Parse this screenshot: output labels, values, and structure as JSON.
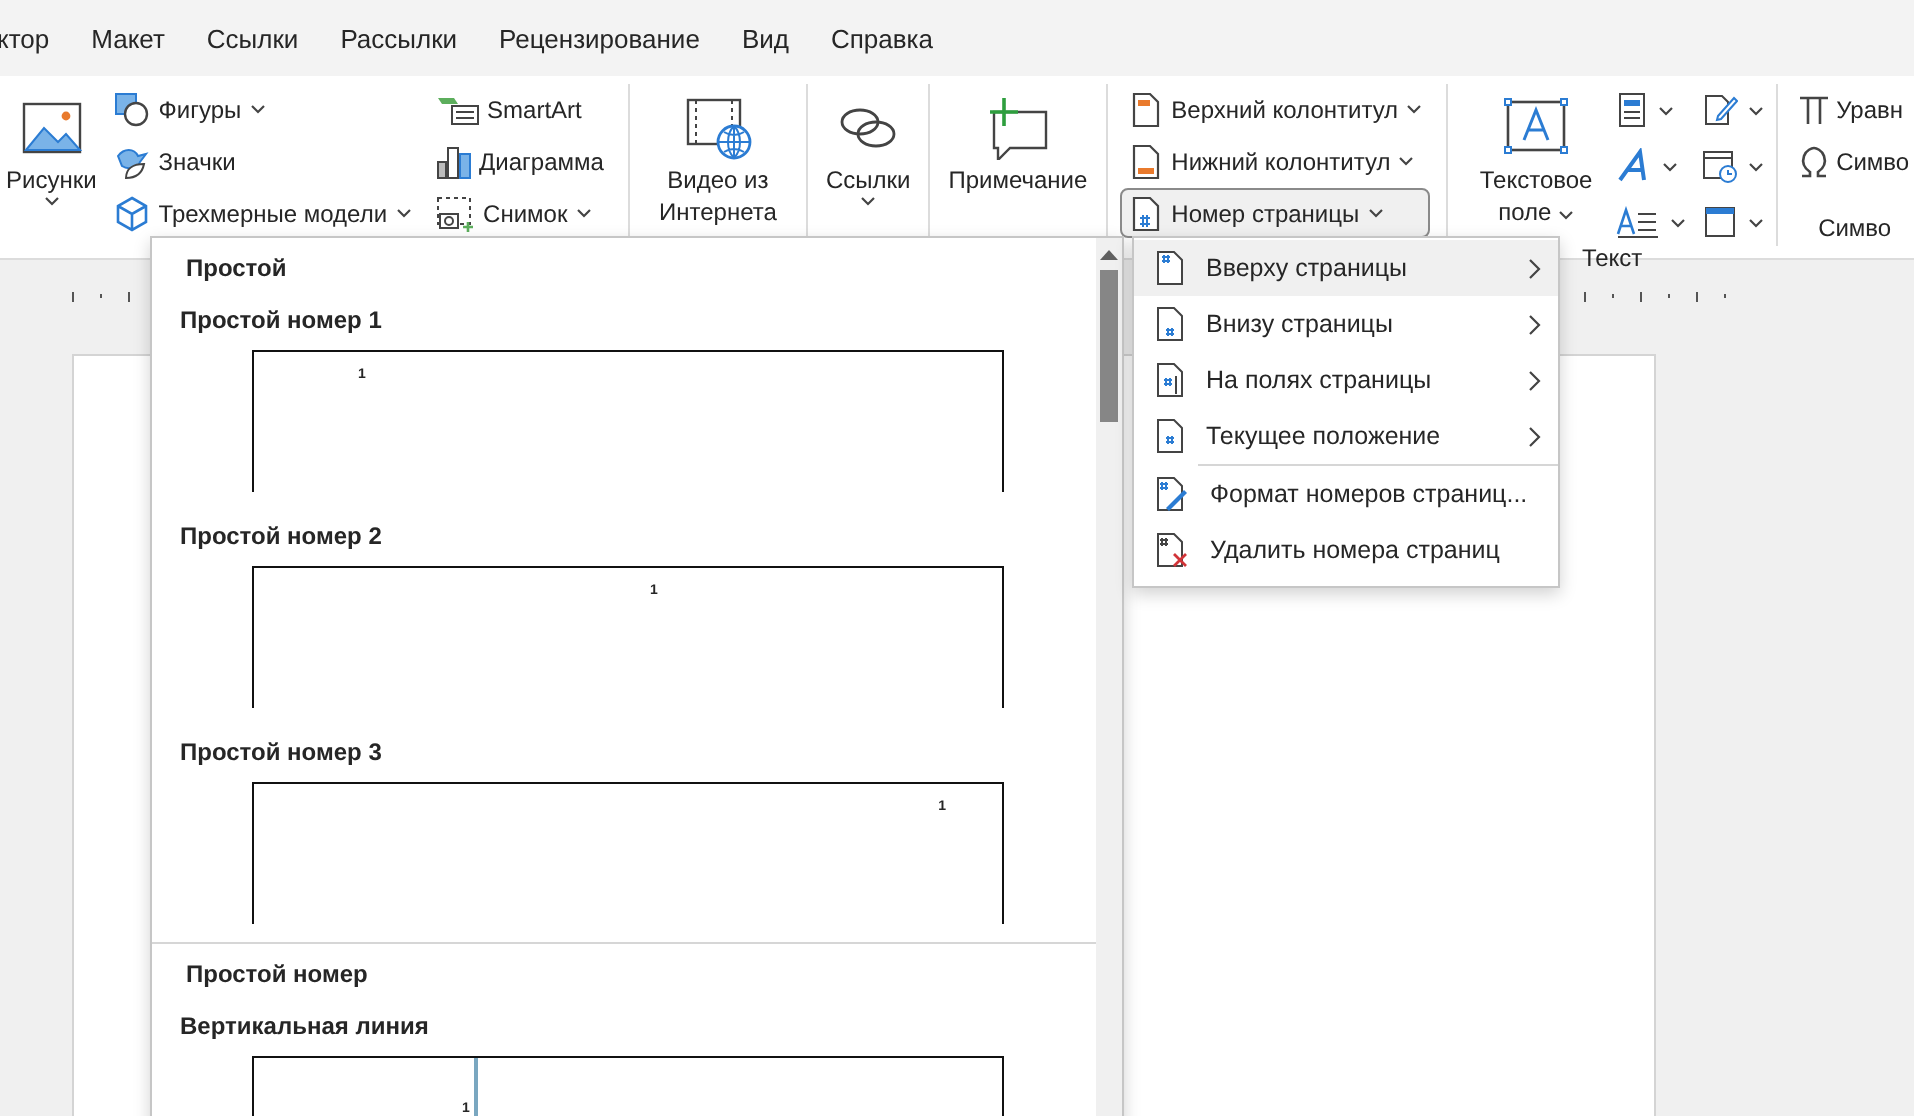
{
  "tabs": [
    {
      "label": "ктор",
      "selected": false
    },
    {
      "label": "Макет",
      "selected": false
    },
    {
      "label": "Ссылки",
      "selected": false
    },
    {
      "label": "Рассылки",
      "selected": false
    },
    {
      "label": "Рецензирование",
      "selected": false
    },
    {
      "label": "Вид",
      "selected": false
    },
    {
      "label": "Справка",
      "selected": false
    }
  ],
  "ribbon": {
    "sections": [
      {
        "controls": [
          {
            "kind": "large",
            "label": "Рисунки",
            "caret": true
          },
          {
            "kind": "stack",
            "items": [
              {
                "label": "Фигуры",
                "caret": true,
                "selected": false
              },
              {
                "label": "Значки",
                "caret": false,
                "selected": false
              },
              {
                "label": "Трехмерные модели",
                "caret": true,
                "selected": false
              }
            ]
          },
          {
            "kind": "stack",
            "items": [
              {
                "label": "SmartArt",
                "caret": false,
                "selected": false
              },
              {
                "label": "Диаграмма",
                "caret": false,
                "selected": false
              },
              {
                "label": "Снимок",
                "caret": true,
                "selected": false
              }
            ]
          }
        ]
      },
      {
        "controls": [
          {
            "kind": "large_wrapped",
            "label": "Видео из Интернета",
            "caret": false
          }
        ]
      },
      {
        "controls": [
          {
            "kind": "large",
            "label": "Ссылки",
            "caret": true
          }
        ]
      },
      {
        "controls": [
          {
            "kind": "large",
            "label": "Примечание",
            "caret": false
          }
        ]
      },
      {
        "controls": [
          {
            "kind": "stack",
            "items": [
              {
                "label": "Верхний колонтитул",
                "caret": true,
                "selected": false
              },
              {
                "label": "Нижний колонтитул",
                "caret": true,
                "selected": false
              },
              {
                "label": "Номер страницы",
                "caret": true,
                "selected": true
              }
            ]
          }
        ]
      },
      {
        "label": "Текст",
        "controls": [
          {
            "kind": "large_wrapped",
            "label": "Текстовое поле",
            "caret": true
          },
          {
            "kind": "icon_grid"
          }
        ]
      },
      {
        "label": "Симво",
        "controls": [
          {
            "kind": "stack",
            "items": [
              {
                "label": "Уравн",
                "caret": false,
                "selected": false
              },
              {
                "label": "Симво",
                "caret": false,
                "selected": false
              }
            ]
          }
        ]
      }
    ]
  },
  "gallery": {
    "groups": [
      {
        "heading": "Простой",
        "entries": [
          {
            "title": "Простой номер 1",
            "number": "1",
            "kind": "number_left"
          },
          {
            "title": "Простой номер 2",
            "number": "1",
            "kind": "number_center"
          },
          {
            "title": "Простой номер 3",
            "number": "1",
            "kind": "number_right"
          }
        ]
      },
      {
        "heading": "Простой номер",
        "entries": [
          {
            "title": "Вертикальная линия",
            "number": "1",
            "kind": "vertical_line"
          }
        ]
      }
    ]
  },
  "menu": {
    "sections": [
      {
        "items": [
          {
            "label": "Вверху страницы",
            "submenu": true,
            "selected": true
          },
          {
            "label": "Внизу страницы",
            "submenu": true,
            "selected": false
          },
          {
            "label": "На полях страницы",
            "submenu": true,
            "selected": false
          },
          {
            "label": "Текущее положение",
            "submenu": true,
            "selected": false
          }
        ]
      },
      {
        "items": [
          {
            "label": "Формат номеров страниц...",
            "submenu": false,
            "selected": false
          },
          {
            "label": "Удалить номера страниц",
            "submenu": false,
            "selected": false
          }
        ]
      }
    ]
  }
}
